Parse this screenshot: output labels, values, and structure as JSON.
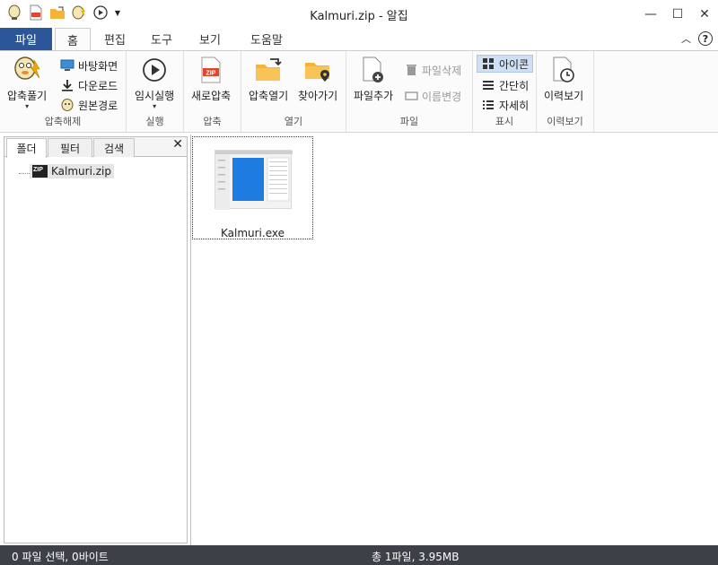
{
  "window": {
    "title": "Kalmuri.zip - 알집"
  },
  "quick_access": [
    "alzip-app-icon",
    "zip-file-icon",
    "folder-open-icon",
    "extract-icon",
    "play-icon",
    "dropdown-icon"
  ],
  "window_controls": {
    "minimize": "—",
    "maximize": "☐",
    "close": "✕"
  },
  "tabs": {
    "file": "파일",
    "home": "홈",
    "edit": "편집",
    "tools": "도구",
    "view": "보기",
    "help": "도움말"
  },
  "ribbon": {
    "extract_group": {
      "label": "압축해제",
      "extract": "압축풀기",
      "desktop": "바탕화면",
      "downloads": "다운로드",
      "original": "원본경로"
    },
    "run_group": {
      "label": "실행",
      "temp_run": "임시실행"
    },
    "compress_group": {
      "label": "압축",
      "new_zip": "새로압축",
      "zip_badge": "ZIP"
    },
    "open_group": {
      "label": "열기",
      "open_zip": "압축열기",
      "locate": "찾아가기"
    },
    "file_group": {
      "label": "파일",
      "add_file": "파일추가",
      "delete_file": "파일삭제",
      "rename": "이름변경"
    },
    "view_group": {
      "label": "표시",
      "icons": "아이콘",
      "simple": "간단히",
      "details": "자세히"
    },
    "history_group": {
      "label": "이력보기",
      "history": "이력보기"
    }
  },
  "left_panel": {
    "tabs": {
      "folder": "폴더",
      "filter": "필터",
      "search": "검색"
    },
    "close": "✕",
    "tree": {
      "root": "Kalmuri.zip",
      "root_badge": "ZIP"
    }
  },
  "main": {
    "files": [
      {
        "name": "Kalmuri.exe"
      }
    ]
  },
  "status": {
    "selection": "0 파일 선택,  0바이트",
    "total": "총 1파일,  3.95MB"
  },
  "colors": {
    "file_tab": "#2b579a",
    "status_bar": "#3d4047",
    "selected_view": "#cfe0f5"
  }
}
